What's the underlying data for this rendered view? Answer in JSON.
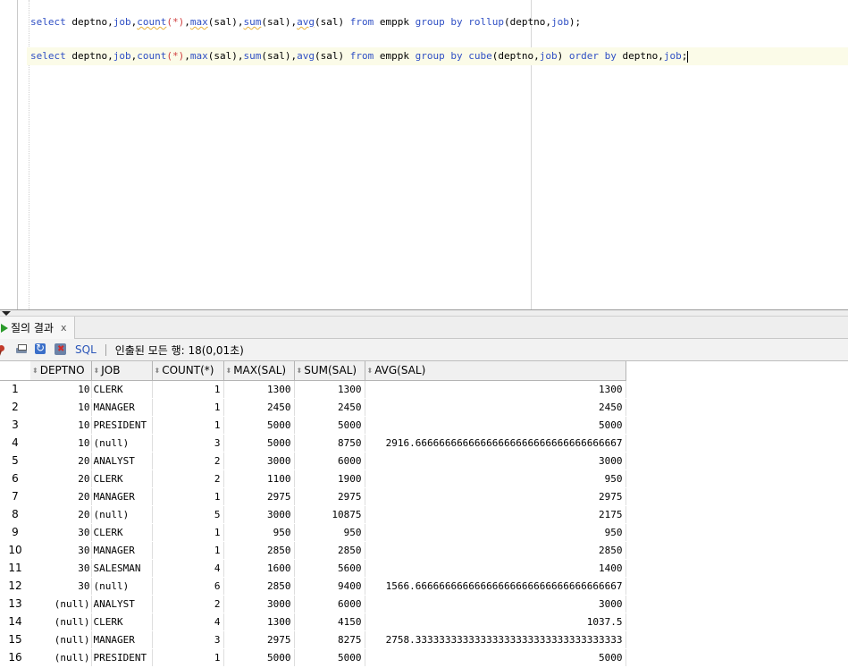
{
  "editor": {
    "line1": {
      "select": "select",
      "cols_a": "deptno,",
      "job": "job",
      "comma1": ",",
      "count": "count",
      "star": "(*)",
      "comma2": ",",
      "max": "max",
      "sal1": "(sal)",
      "comma3": ",",
      "sum": "sum",
      "sal2": "(sal)",
      "comma4": ",",
      "avg": "avg",
      "sal3": "(sal)",
      "from": "from",
      "table": "emppk",
      "group": "group",
      "by": "by",
      "rollup": "rollup",
      "args": "(deptno,",
      "job2": "job",
      "end": ");"
    },
    "line2": {
      "select": "select",
      "cols_a": "deptno,",
      "job": "job",
      "comma1": ",",
      "count": "count",
      "star": "(*)",
      "comma2": ",",
      "max": "max",
      "sal1": "(sal)",
      "comma3": ",",
      "sum": "sum",
      "sal2": "(sal)",
      "comma4": ",",
      "avg": "avg",
      "sal3": "(sal)",
      "from": "from",
      "table": "emppk",
      "group": "group",
      "by": "by",
      "cube": "cube",
      "args": "(deptno,",
      "job2": "job",
      "close": ")",
      "order": "order",
      "by2": "by",
      "deptno": "deptno,",
      "job3": "job",
      "end": ";"
    }
  },
  "results_tab": {
    "label": "질의 결과",
    "close": "x"
  },
  "toolbar": {
    "sql_label": "SQL",
    "separator": "|",
    "status": "인출된 모든 행: 18(0,01초)"
  },
  "grid": {
    "columns": [
      "DEPTNO",
      "JOB",
      "COUNT(*)",
      "MAX(SAL)",
      "SUM(SAL)",
      "AVG(SAL)"
    ],
    "rows": [
      {
        "n": "1",
        "deptno": "10",
        "job": "CLERK",
        "count": "1",
        "max": "1300",
        "sum": "1300",
        "avg": "1300"
      },
      {
        "n": "2",
        "deptno": "10",
        "job": "MANAGER",
        "count": "1",
        "max": "2450",
        "sum": "2450",
        "avg": "2450"
      },
      {
        "n": "3",
        "deptno": "10",
        "job": "PRESIDENT",
        "count": "1",
        "max": "5000",
        "sum": "5000",
        "avg": "5000"
      },
      {
        "n": "4",
        "deptno": "10",
        "job": "(null)",
        "count": "3",
        "max": "5000",
        "sum": "8750",
        "avg": "2916.66666666666666666666666666666666667"
      },
      {
        "n": "5",
        "deptno": "20",
        "job": "ANALYST",
        "count": "2",
        "max": "3000",
        "sum": "6000",
        "avg": "3000"
      },
      {
        "n": "6",
        "deptno": "20",
        "job": "CLERK",
        "count": "2",
        "max": "1100",
        "sum": "1900",
        "avg": "950"
      },
      {
        "n": "7",
        "deptno": "20",
        "job": "MANAGER",
        "count": "1",
        "max": "2975",
        "sum": "2975",
        "avg": "2975"
      },
      {
        "n": "8",
        "deptno": "20",
        "job": "(null)",
        "count": "5",
        "max": "3000",
        "sum": "10875",
        "avg": "2175"
      },
      {
        "n": "9",
        "deptno": "30",
        "job": "CLERK",
        "count": "1",
        "max": "950",
        "sum": "950",
        "avg": "950"
      },
      {
        "n": "10",
        "deptno": "30",
        "job": "MANAGER",
        "count": "1",
        "max": "2850",
        "sum": "2850",
        "avg": "2850"
      },
      {
        "n": "11",
        "deptno": "30",
        "job": "SALESMAN",
        "count": "4",
        "max": "1600",
        "sum": "5600",
        "avg": "1400"
      },
      {
        "n": "12",
        "deptno": "30",
        "job": "(null)",
        "count": "6",
        "max": "2850",
        "sum": "9400",
        "avg": "1566.66666666666666666666666666666666667"
      },
      {
        "n": "13",
        "deptno": "(null)",
        "job": "ANALYST",
        "count": "2",
        "max": "3000",
        "sum": "6000",
        "avg": "3000"
      },
      {
        "n": "14",
        "deptno": "(null)",
        "job": "CLERK",
        "count": "4",
        "max": "1300",
        "sum": "4150",
        "avg": "1037.5"
      },
      {
        "n": "15",
        "deptno": "(null)",
        "job": "MANAGER",
        "count": "3",
        "max": "2975",
        "sum": "8275",
        "avg": "2758.33333333333333333333333333333333333"
      },
      {
        "n": "16",
        "deptno": "(null)",
        "job": "PRESIDENT",
        "count": "1",
        "max": "5000",
        "sum": "5000",
        "avg": "5000"
      }
    ]
  },
  "colors": {
    "keyword": "#2f4fc4",
    "current_line": "#fbfbe8",
    "run_icon": "#2a9a2a",
    "sql_link": "#2a55b8"
  }
}
